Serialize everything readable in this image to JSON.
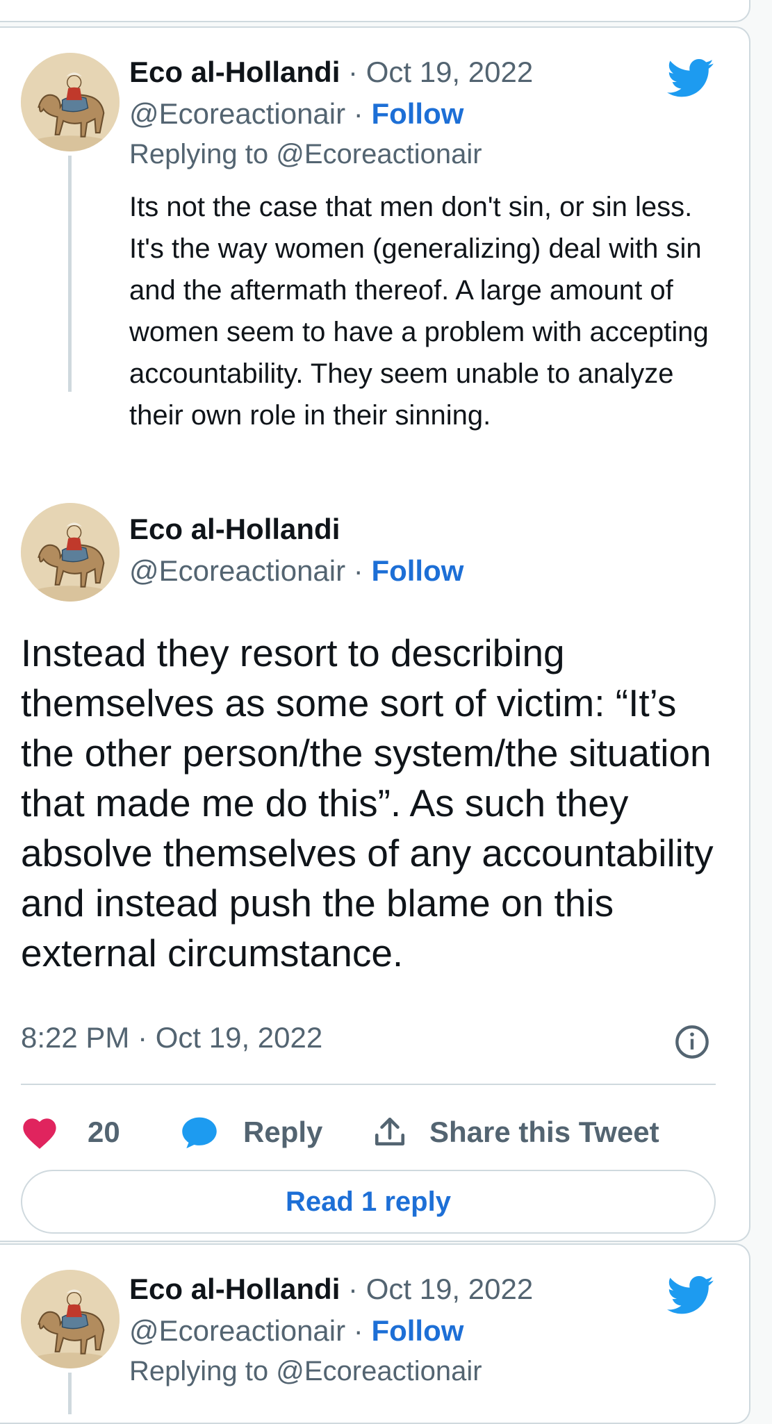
{
  "colors": {
    "accent": "#1d6fd6",
    "like": "#e0245e",
    "bird": "#1d9bf0",
    "muted": "#536471",
    "border": "#cfd9de"
  },
  "reply_tweet": {
    "author": "Eco al-Hollandi",
    "separator": " · ",
    "date": "Oct 19, 2022",
    "handle": "@Ecoreactionair",
    "follow_label": "Follow",
    "replying_to": "Replying to @Ecoreactionair",
    "text": "Its not the case that men don't sin, or sin less. It's the way women (generalizing) deal with sin and the aftermath thereof. A large amount of women seem to have a problem with accepting accountability. They seem unable to analyze their own role in their sinning."
  },
  "main_tweet": {
    "author": "Eco al-Hollandi",
    "handle": "@Ecoreactionair",
    "separator": " · ",
    "follow_label": "Follow",
    "text": "Instead they resort to describing themselves as some sort of victim: “It’s the other person/the system/the situation that made me do this”. As such they absolve themselves of any accountability and instead push the blame on this external circumstance.",
    "timestamp": "8:22 PM · Oct 19, 2022",
    "like_count": "20",
    "reply_label": "Reply",
    "share_label": "Share this Tweet",
    "read_replies_label": "Read 1 reply"
  },
  "next_tweet": {
    "author": "Eco al-Hollandi",
    "separator": " · ",
    "date": "Oct 19, 2022",
    "handle": "@Ecoreactionair",
    "follow_label": "Follow",
    "replying_to": "Replying to @Ecoreactionair"
  },
  "icons": {
    "logo": "twitter-bird-icon",
    "like": "heart-icon",
    "reply": "speech-bubble-icon",
    "share": "share-upload-icon",
    "info": "info-icon"
  }
}
